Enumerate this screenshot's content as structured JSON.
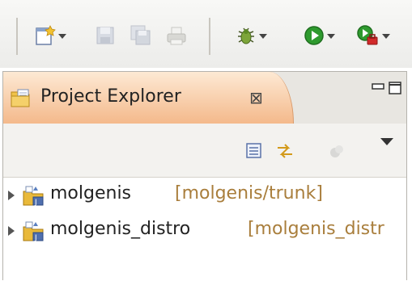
{
  "toolbar": {
    "buttons": [
      {
        "icon": "new-wizard-icon",
        "dropdown": true
      },
      {
        "icon": "save-icon",
        "dropdown": false
      },
      {
        "icon": "save-all-icon",
        "dropdown": false
      },
      {
        "icon": "print-icon",
        "dropdown": false
      },
      {
        "icon": "debug-icon",
        "dropdown": true
      },
      {
        "icon": "run-icon",
        "dropdown": true
      },
      {
        "icon": "external-tools-icon",
        "dropdown": true
      }
    ]
  },
  "view": {
    "tab_title": "Project Explorer",
    "close_glyph": "⊠",
    "accent_color": "#f4b98b"
  },
  "tree": {
    "items": [
      {
        "name": "molgenis",
        "location": "[molgenis/trunk]"
      },
      {
        "name": "molgenis_distro",
        "location": "[molgenis_distr"
      }
    ]
  }
}
